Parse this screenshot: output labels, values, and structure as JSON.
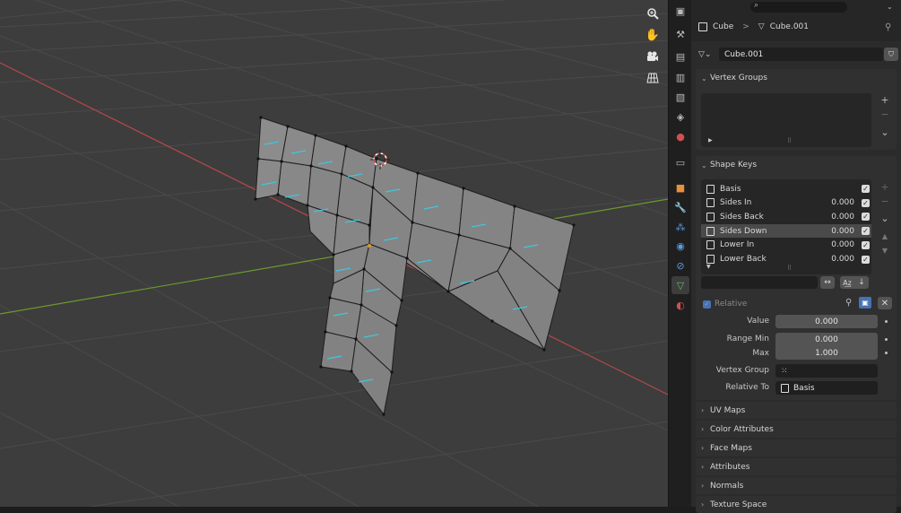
{
  "viewport": {
    "nav_icons": [
      "zoom-icon",
      "hand-pan-icon",
      "camera-icon",
      "grid-icon"
    ]
  },
  "header": {
    "breadcrumb_object": "Cube",
    "breadcrumb_separator": ">",
    "breadcrumb_mesh": "Cube.001",
    "mesh_name": "Cube.001"
  },
  "vertex_groups": {
    "title": "Vertex Groups"
  },
  "shape_keys": {
    "title": "Shape Keys",
    "items": [
      {
        "name": "Basis",
        "value": "",
        "checked": true
      },
      {
        "name": "Sides In",
        "value": "0.000",
        "checked": true
      },
      {
        "name": "Sides Back",
        "value": "0.000",
        "checked": true
      },
      {
        "name": "Sides Down",
        "value": "0.000",
        "checked": true
      },
      {
        "name": "Lower In",
        "value": "0.000",
        "checked": true
      },
      {
        "name": "Lower Back",
        "value": "0.000",
        "checked": true
      }
    ],
    "relative_label": "Relative",
    "value_label": "Value",
    "value": "0.000",
    "range_min_label": "Range Min",
    "range_min": "0.000",
    "max_label": "Max",
    "max": "1.000",
    "vertex_group_label": "Vertex Group",
    "relative_to_label": "Relative To",
    "relative_to": "Basis"
  },
  "collapsed_panels": [
    "UV Maps",
    "Color Attributes",
    "Face Maps",
    "Attributes",
    "Normals",
    "Texture Space"
  ],
  "colors": {
    "viewport_bg": "#3d3d3d",
    "x_axis": "#b84848",
    "y_axis": "#6b9a2d",
    "mesh_face": "#8a8a8a",
    "normal_line": "#3fc6e0"
  }
}
